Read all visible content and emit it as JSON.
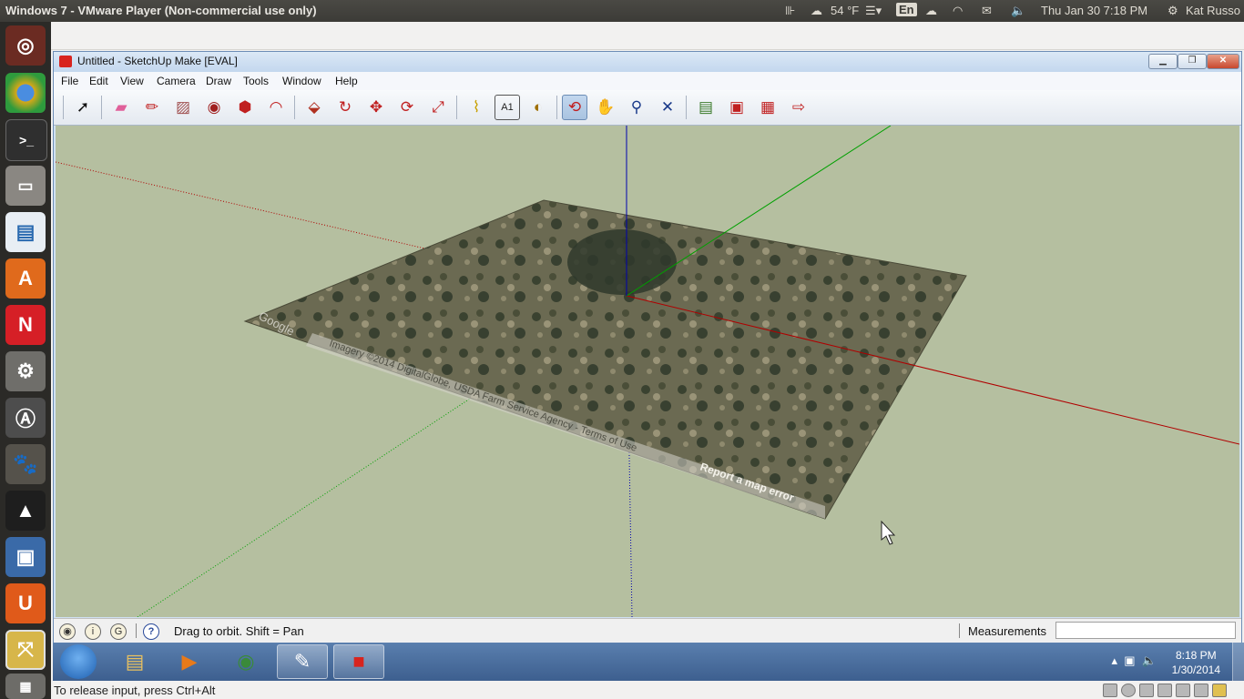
{
  "ubuntu_panel": {
    "window_title": "Windows 7 - VMware Player (Non-commercial use only)",
    "temperature": "54 °F",
    "keyboard_layout": "En",
    "datetime": "Thu Jan 30   7:18 PM",
    "user": "Kat Russo"
  },
  "launcher": {
    "items": [
      {
        "name": "Dash"
      },
      {
        "name": "Chrome"
      },
      {
        "name": "Terminal"
      },
      {
        "name": "Files"
      },
      {
        "name": "Writer"
      },
      {
        "name": "Software Center"
      },
      {
        "name": "Netflix"
      },
      {
        "name": "System Settings"
      },
      {
        "name": "Update Manager"
      },
      {
        "name": "GIMP"
      },
      {
        "name": "Inkscape"
      },
      {
        "name": "Shotwell"
      },
      {
        "name": "Ubuntu One"
      },
      {
        "name": "VMware Player"
      }
    ]
  },
  "sketchup": {
    "title": "Untitled - SketchUp Make [EVAL]",
    "menu": [
      "File",
      "Edit",
      "View",
      "Camera",
      "Draw",
      "Tools",
      "Window",
      "Help"
    ],
    "tools": [
      {
        "name": "select",
        "glyph": "➚"
      },
      {
        "name": "eraser",
        "glyph": "▰"
      },
      {
        "name": "pencil",
        "glyph": "✏"
      },
      {
        "name": "rectangle",
        "glyph": "▨"
      },
      {
        "name": "circle",
        "glyph": "◉"
      },
      {
        "name": "polygon",
        "glyph": "⬢"
      },
      {
        "name": "arc",
        "glyph": "◠"
      },
      {
        "name": "push-pull",
        "glyph": "⬙"
      },
      {
        "name": "follow-me",
        "glyph": "↻"
      },
      {
        "name": "move",
        "glyph": "✥"
      },
      {
        "name": "rotate",
        "glyph": "⟳"
      },
      {
        "name": "scale",
        "glyph": "⤢"
      },
      {
        "name": "tape-measure",
        "glyph": "⌇"
      },
      {
        "name": "text",
        "glyph": "A1"
      },
      {
        "name": "paint-bucket",
        "glyph": "◐"
      },
      {
        "name": "orbit",
        "glyph": "⟲"
      },
      {
        "name": "pan",
        "glyph": "✋"
      },
      {
        "name": "zoom",
        "glyph": "⚲"
      },
      {
        "name": "zoom-extents",
        "glyph": "✕"
      },
      {
        "name": "add-location",
        "glyph": "▤"
      },
      {
        "name": "3d-warehouse",
        "glyph": "▣"
      },
      {
        "name": "extension-warehouse",
        "glyph": "▦"
      },
      {
        "name": "share-model",
        "glyph": "⇨"
      }
    ],
    "active_tool": "orbit",
    "map_labels": {
      "google": "Google",
      "imagery": "Imagery ©2014 DigitalGlobe, USDA Farm Service Agency - Terms of Use",
      "report": "Report a map error"
    },
    "status": {
      "hint": "Drag to orbit.  Shift = Pan",
      "measurements_label": "Measurements",
      "measurements_value": ""
    }
  },
  "taskbar": {
    "time": "8:18 PM",
    "date": "1/30/2014"
  },
  "vmware": {
    "release_hint": "To release input, press Ctrl+Alt"
  },
  "colors": {
    "viewport_bg": "#b5bfa0",
    "red_axis": "#b00000",
    "green_axis": "#00a000",
    "blue_axis": "#0000b0"
  }
}
